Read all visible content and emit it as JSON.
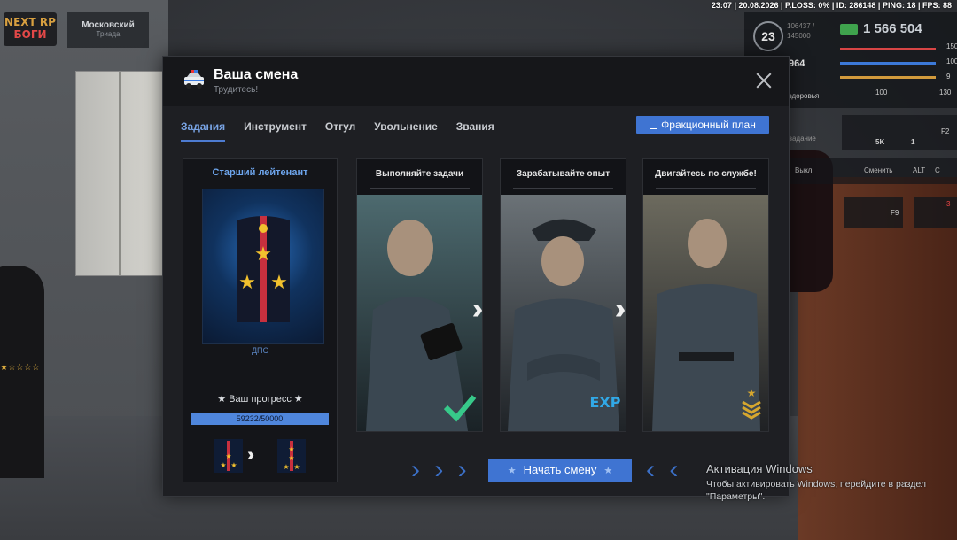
{
  "hud": {
    "topbar": "23:07 | 20.08.2026 | P.LOSS: 0% | ID: 286148 | PING: 18 | FPS: 88",
    "logo_line1": "NEXT RP",
    "logo_line2": "БОГИ",
    "district_name": "Московский",
    "district_sub": "Триада",
    "level": "23",
    "xp_line1": "106437 /",
    "xp_line2": "145000",
    "money": "1 566 504",
    "health": "150",
    "armor": "100",
    "hunger": "9",
    "stat_100": "100",
    "stat_130": "130",
    "stat_964": "964",
    "label_health": "здоровья",
    "bonus_5k": "5K",
    "bonus_1": "1",
    "daily_task": "Ежедневное задание",
    "key_f2": "F2",
    "toggle_label": "Выкл.",
    "switch_label": "Сменить",
    "key_alt": "ALT",
    "key_c": "C",
    "key_f9": "F9",
    "notif_count": "3"
  },
  "window": {
    "title": "Ваша смена",
    "subtitle": "Трудитесь!",
    "tabs": [
      {
        "label": "Задания"
      },
      {
        "label": "Инструмент"
      },
      {
        "label": "Отгул"
      },
      {
        "label": "Увольнение"
      },
      {
        "label": "Звания"
      }
    ],
    "plan_button": "Фракционный план",
    "rank": {
      "title": "Старший лейтенант",
      "department": "ДПС",
      "progress_label": "★ Ваш прогресс ★",
      "progress_text": "59232/50000",
      "progress_fraction": 1.0
    },
    "steps": [
      {
        "title": "Выполняйте задачи",
        "badge": "check"
      },
      {
        "title": "Зарабатывайте опыт",
        "badge": "EXP"
      },
      {
        "title": "Двигайтесь по службе!",
        "badge": "chevrons"
      }
    ],
    "start_button": "Начать смену"
  },
  "activation": {
    "title": "Активация Windows",
    "line1": "Чтобы активировать Windows, перейдите в раздел",
    "line2": "\"Параметры\"."
  },
  "colors": {
    "accent": "#3f74d2",
    "title_blue": "#6ea6ee"
  }
}
